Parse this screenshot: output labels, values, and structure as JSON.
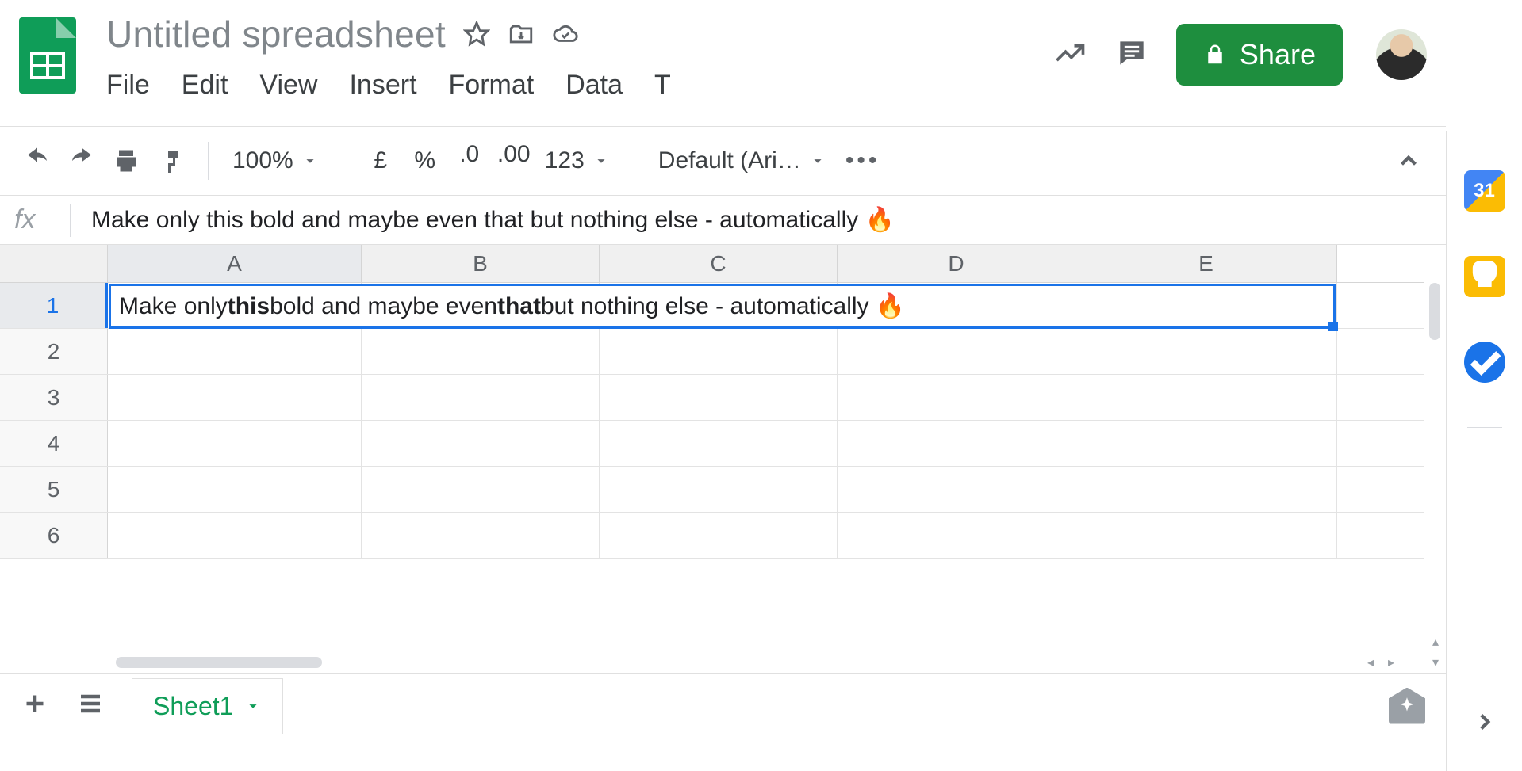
{
  "doc": {
    "title": "Untitled spreadsheet"
  },
  "menus": {
    "file": "File",
    "edit": "Edit",
    "view": "View",
    "insert": "Insert",
    "format": "Format",
    "data": "Data",
    "tools_initial": "T"
  },
  "header_actions": {
    "share": "Share"
  },
  "toolbar": {
    "zoom": "100%",
    "currency": "£",
    "percent": "%",
    "dec_dec": ".0",
    "inc_dec": ".00",
    "numfmt": "123",
    "font": "Default (Ari…"
  },
  "formula_bar": {
    "fx": "fx",
    "text": "Make only this bold and maybe even that but nothing else - automatically 🔥"
  },
  "columns": {
    "A": "A",
    "B": "B",
    "C": "C",
    "D": "D",
    "E": "E"
  },
  "rows": {
    "r1": "1",
    "r2": "2",
    "r3": "3",
    "r4": "4",
    "r5": "5",
    "r6": "6"
  },
  "cellA1": {
    "seg1": "Make only ",
    "bold1": "this",
    "seg2": " bold and maybe even ",
    "bold2": "that",
    "seg3": " but nothing else - automatically 🔥"
  },
  "sheet": {
    "name": "Sheet1"
  },
  "sidepanel": {
    "calendar": "31"
  }
}
